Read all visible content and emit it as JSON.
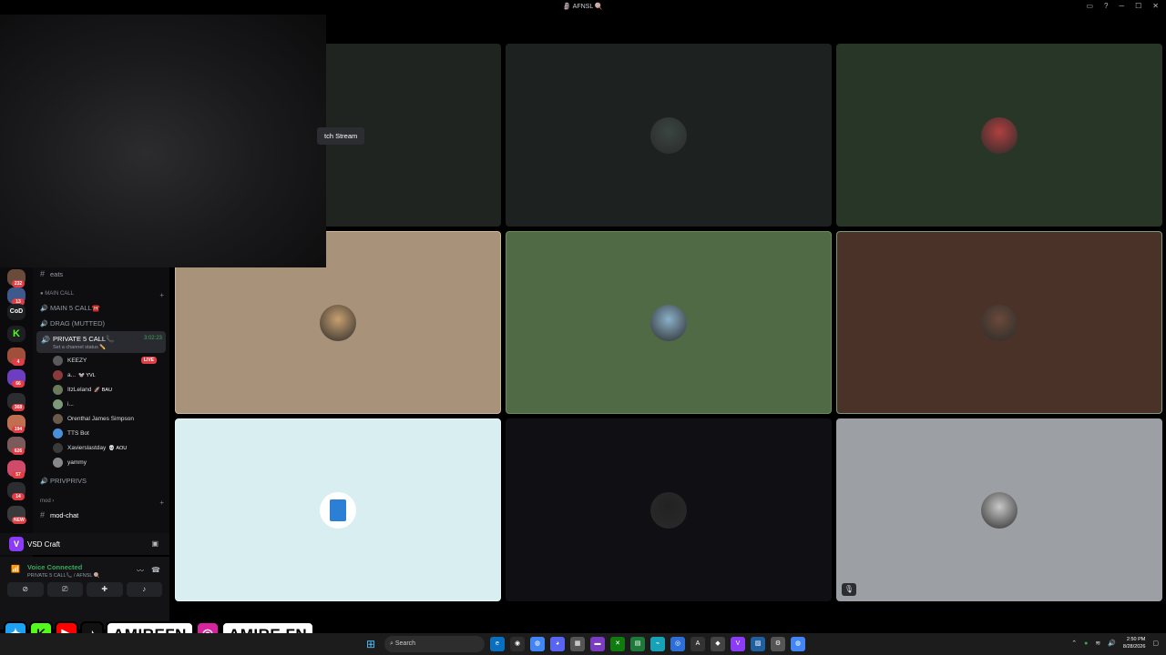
{
  "window": {
    "title": "🗿 AFNSL 🍭"
  },
  "rail": {
    "items": [
      {
        "label": "",
        "badge": "232",
        "color": "#6a4a3a"
      },
      {
        "label": "",
        "badge": "13",
        "color": "#3d5a8a"
      },
      {
        "label": "CoD",
        "badge": "",
        "color": "#1e1f22"
      },
      {
        "label": "K",
        "badge": "",
        "color": "#1e1f22"
      },
      {
        "label": "",
        "badge": "4",
        "color": "#a0503a"
      },
      {
        "label": "",
        "badge": "66",
        "color": "#6c3fc0"
      },
      {
        "label": "",
        "badge": "368",
        "color": "#2b2d31"
      },
      {
        "label": "",
        "badge": "194",
        "color": "#c07050"
      },
      {
        "label": "",
        "badge": "626",
        "color": "#7a5a5a"
      },
      {
        "label": "",
        "badge": "57",
        "color": "#d04a6a"
      },
      {
        "label": "",
        "badge": "14",
        "color": "#2b2d31"
      },
      {
        "label": "",
        "badge": "NEW",
        "color": "#3a3a3a"
      }
    ]
  },
  "channels": {
    "eats": "eats",
    "main_call_category": "MAIN CALL",
    "main5": "MAIN 5 CALL☎️",
    "drag": "DRAG (MUTTED)",
    "private5": "PRIVATE 5 CALL📞",
    "private5_status": "Set a channel status ✏️",
    "private5_timer": "3:02:23",
    "members": [
      {
        "name": "KEEZY",
        "tag": "",
        "live": "LIVE",
        "color": "#5a5a5a"
      },
      {
        "name": "a...",
        "tag": "🐭 YVL",
        "live": "",
        "color": "#8a3a3a"
      },
      {
        "name": "ItzLeland",
        "tag": "🚀 BAU",
        "live": "",
        "color": "#6a7a5a"
      },
      {
        "name": "i...",
        "tag": "",
        "live": "",
        "color": "#7a9a7a"
      },
      {
        "name": "Orenthal James Simpson",
        "tag": "",
        "live": "",
        "color": "#6a5a4a"
      },
      {
        "name": "TTS Bot",
        "tag": "",
        "live": "",
        "color": "#4a90d9"
      },
      {
        "name": "Xavierslastday",
        "tag": "💀 AOU",
        "live": "",
        "color": "#3a3a3a"
      },
      {
        "name": "yammy",
        "tag": "",
        "live": "",
        "color": "#888"
      }
    ],
    "privprivs": "PRIVPRIVS",
    "mod_category": "mod",
    "mod_chat": "mod-chat"
  },
  "server_panel": {
    "name": "VSD Craft",
    "logo": "V"
  },
  "voice": {
    "status": "Voice Connected",
    "sub": "PRIVATE 5 CALL📞 / AFNSL 🍭"
  },
  "stream": {
    "watch_label": "tch Stream"
  },
  "tiles": [
    {
      "bg": "#1f2420",
      "avatar_color": "",
      "has_avatar": false,
      "border": "none"
    },
    {
      "bg": "#1d2220",
      "avatar_color": "#3a4540",
      "has_avatar": true,
      "border": "none"
    },
    {
      "bg": "#283628",
      "avatar_color": "#b04040",
      "has_avatar": true,
      "border": "none"
    },
    {
      "bg": "#a8927a",
      "avatar_color": "#c8a070",
      "has_avatar": true,
      "border": "1px solid #cbb59c"
    },
    {
      "bg": "#4f6a45",
      "avatar_color": "#8ab0c8",
      "has_avatar": true,
      "border": "1px solid #6a8a5a"
    },
    {
      "bg": "#4a3228",
      "avatar_color": "#6a4a3a",
      "has_avatar": true,
      "border": "1px solid #7a9a7a"
    },
    {
      "bg": "#d9eef0",
      "avatar_color": "",
      "has_avatar": false,
      "border": "1px solid #e8f4f5",
      "doc": true
    },
    {
      "bg": "#0f0f14",
      "avatar_color": "#222",
      "has_avatar": true,
      "border": "none"
    },
    {
      "bg": "#9c9fa3",
      "avatar_color": "#c8c8c8",
      "has_avatar": true,
      "border": "none",
      "muted": true
    }
  ],
  "social": {
    "handle1": "AMIREFN",
    "handle2": "AMIRE.FN"
  },
  "taskbar": {
    "search": "Search",
    "time": "2:50 PM",
    "date": "8/28/2026"
  },
  "colors": {
    "accent": "#5865f2",
    "green": "#3ba55d",
    "red": "#e23d44"
  }
}
